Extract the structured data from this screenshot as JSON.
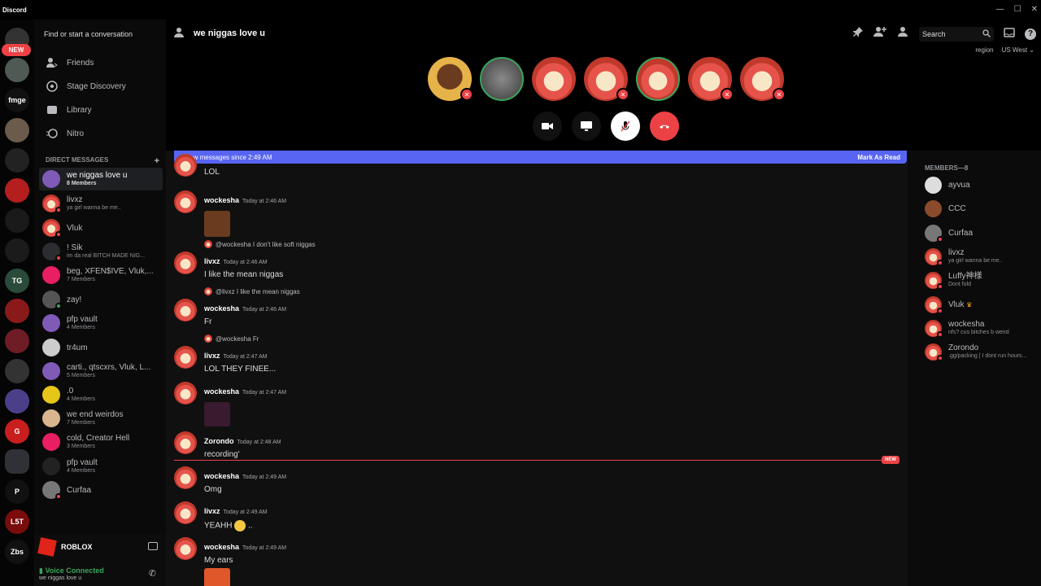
{
  "app": {
    "name": "Discord"
  },
  "servers": {
    "new_badge": "NEW",
    "labels": [
      "fmge",
      "TG",
      "G",
      "P",
      "L5T",
      "Zbs"
    ]
  },
  "search": {
    "placeholder": "Find or start a conversation"
  },
  "nav": {
    "friends": "Friends",
    "stage": "Stage Discovery",
    "library": "Library",
    "nitro": "Nitro"
  },
  "dm_header": {
    "label": "DIRECT MESSAGES",
    "add": "+"
  },
  "dms": [
    {
      "name": "we niggas love u",
      "sub": "8 Members"
    },
    {
      "name": "livxz",
      "sub": "ya girl wanna be me.."
    },
    {
      "name": "Vluk",
      "sub": ""
    },
    {
      "name": "! Sik",
      "sub": "im da real BITCH MADE NIG..."
    },
    {
      "name": "beg, XFEN$IVE, Vluk,...",
      "sub": "7 Members"
    },
    {
      "name": "zay!",
      "sub": ""
    },
    {
      "name": "pfp vault",
      "sub": "4 Members"
    },
    {
      "name": "tr4um",
      "sub": ""
    },
    {
      "name": "carti., qtscxrs, Vluk, L...",
      "sub": "5 Members"
    },
    {
      "name": ".0",
      "sub": "4 Members"
    },
    {
      "name": "we end weirdos",
      "sub": "7 Members"
    },
    {
      "name": "cold, Creator Hell",
      "sub": "3 Members"
    },
    {
      "name": "pfp vault",
      "sub": "4 Members"
    },
    {
      "name": "Curfaa",
      "sub": ""
    }
  ],
  "activity": {
    "game": "ROBLOX"
  },
  "voice_status": {
    "title": "Voice Connected",
    "channel": "we niggas love u"
  },
  "channel": {
    "title": "we niggas love u"
  },
  "top": {
    "search": "Search",
    "region_label": "region",
    "region_value": "US West"
  },
  "banner": {
    "text": "4 new messages since 2:49 AM",
    "action": "Mark As Read"
  },
  "messages": [
    {
      "author": "",
      "time": "",
      "text": "LOL"
    },
    {
      "author": "wockesha",
      "time": "Today at 2:46 AM",
      "text": ""
    },
    {
      "reply": "@wockesha I don't like soft niggas",
      "author": "livxz",
      "time": "Today at 2:46 AM",
      "text": "I like the mean niggas"
    },
    {
      "reply": "@livxz I like the mean niggas",
      "author": "wockesha",
      "time": "Today at 2:46 AM",
      "text": "Fr"
    },
    {
      "reply": "@wockesha Fr",
      "author": "livxz",
      "time": "Today at 2:47 AM",
      "text": "LOL THEY FINEE..."
    },
    {
      "author": "wockesha",
      "time": "Today at 2:47 AM",
      "text": ""
    },
    {
      "author": "Zorondo",
      "time": "Today at 2:48 AM",
      "text": "recording'"
    },
    {
      "author": "wockesha",
      "time": "Today at 2:49 AM",
      "text": "Omg"
    },
    {
      "author": "livxz",
      "time": "Today at 2:49 AM",
      "text": "YEAHH",
      "text_after_emoji": ".."
    },
    {
      "author": "wockesha",
      "time": "Today at 2:49 AM",
      "text": "My ears"
    }
  ],
  "new_divider": "NEW",
  "members_header": "MEMBERS—8",
  "members": [
    {
      "name": "ayvua",
      "sub": ""
    },
    {
      "name": "CCC",
      "sub": ""
    },
    {
      "name": "Curfaa",
      "sub": ""
    },
    {
      "name": "livxz",
      "sub": "ya girl wanna be me.."
    },
    {
      "name": "Luffy神様",
      "sub": "Dont fold"
    },
    {
      "name": "Vluk",
      "sub": ""
    },
    {
      "name": "wockesha",
      "sub": "nfs? cus bitches b weird"
    },
    {
      "name": "Zorondo",
      "sub": ".gg/packing | I dont run hours..."
    }
  ],
  "colors": {
    "blurple": "#5865f2",
    "red": "#ed4245",
    "green": "#3ba55c"
  }
}
